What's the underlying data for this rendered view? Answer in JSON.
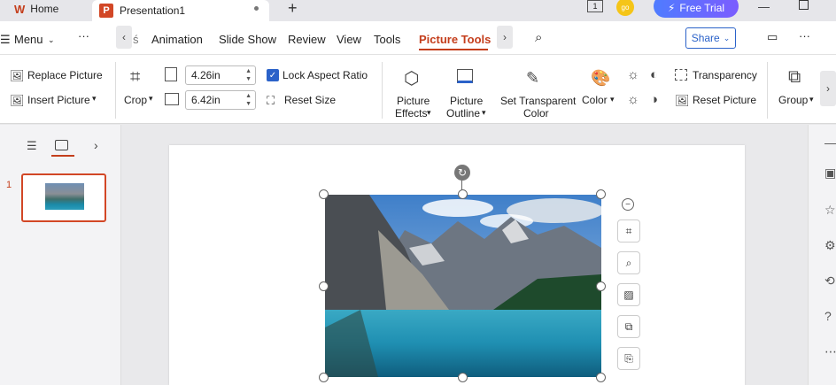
{
  "titlebar": {
    "home_label": "Home",
    "doc_title": "Presentation1",
    "free_trial_label": "Free Trial",
    "avatar_text": "go",
    "badge_text": "1"
  },
  "menubar": {
    "menu_label": "Menu",
    "items": [
      "Animation",
      "Slide Show",
      "Review",
      "View",
      "Tools",
      "Picture Tools"
    ],
    "share_label": "Share"
  },
  "ribbon": {
    "replace_picture": "Replace Picture",
    "insert_picture": "Insert Picture",
    "crop": "Crop",
    "height_value": "4.26in",
    "width_value": "6.42in",
    "lock_aspect_ratio": "Lock Aspect Ratio",
    "reset_size": "Reset Size",
    "picture_effects_1": "Picture",
    "picture_effects_2": "Effects",
    "picture_outline_1": "Picture",
    "picture_outline_2": "Outline",
    "set_transparent_1": "Set Transparent",
    "set_transparent_2": "Color",
    "color": "Color",
    "transparency": "Transparency",
    "reset_picture": "Reset Picture",
    "group": "Group"
  },
  "slides": {
    "slide_number": "1"
  },
  "colors": {
    "accent": "#c43e1c",
    "brand_blue": "#2b62c9"
  }
}
